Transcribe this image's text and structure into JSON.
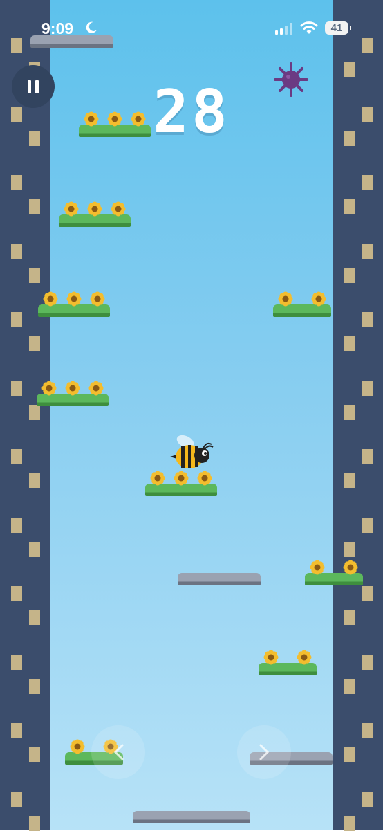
{
  "status_bar": {
    "time": "9:09",
    "battery": "41",
    "moon_icon": "moon-icon",
    "signal_icon": "cellular-signal-icon",
    "wifi_icon": "wifi-icon"
  },
  "hud": {
    "score": "28",
    "pause_icon": "pause-icon"
  },
  "hazard": {
    "icon": "spiky-ball-icon",
    "color": "#6b3a83"
  },
  "player": {
    "icon": "bee-icon"
  },
  "controls": {
    "left_icon": "chevron-left-icon",
    "right_icon": "chevron-right-icon"
  },
  "platforms": [
    {
      "type": "stone",
      "flowers": 0
    },
    {
      "type": "grass",
      "flowers": 3
    },
    {
      "type": "grass",
      "flowers": 3
    },
    {
      "type": "grass",
      "flowers": 3
    },
    {
      "type": "grass",
      "flowers": 2
    },
    {
      "type": "grass",
      "flowers": 3
    },
    {
      "type": "grass",
      "flowers": 3
    },
    {
      "type": "stone",
      "flowers": 0
    },
    {
      "type": "grass",
      "flowers": 2
    },
    {
      "type": "grass",
      "flowers": 2
    },
    {
      "type": "grass",
      "flowers": 2
    },
    {
      "type": "stone",
      "flowers": 0
    },
    {
      "type": "stone",
      "flowers": 0
    }
  ],
  "colors": {
    "sky_top": "#5dc1ec",
    "sky_bottom": "#b7e2f7",
    "wall": "#3b4d6c",
    "brick": "#c5b489",
    "grass": "#5cb85c",
    "stone": "#9aa2b1",
    "flower_petal": "#f3bd2e",
    "flower_center": "#8a5a14"
  }
}
